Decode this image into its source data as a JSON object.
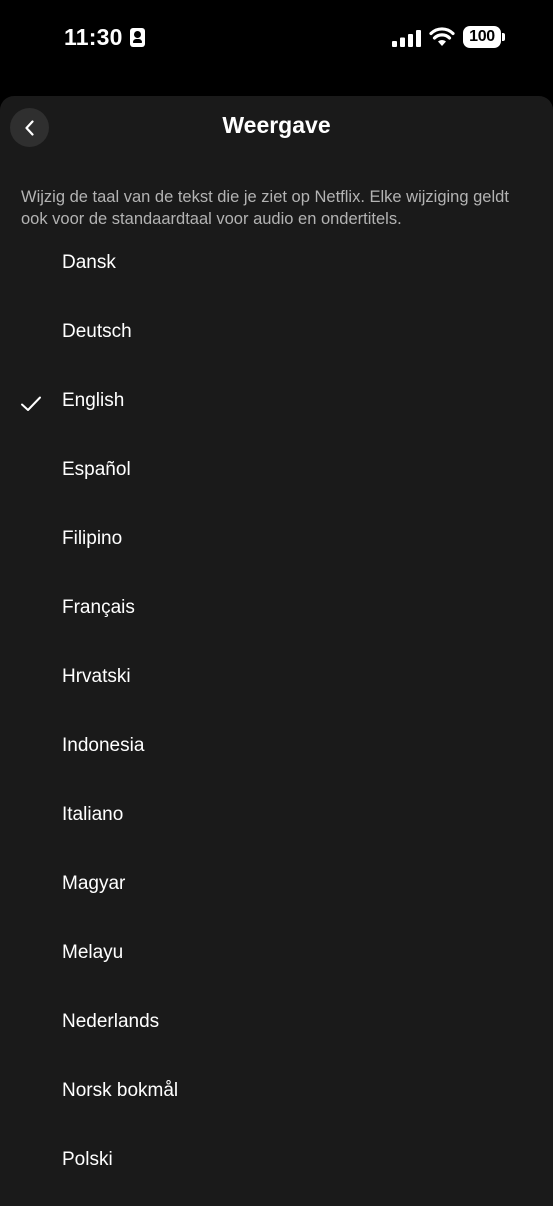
{
  "status_bar": {
    "time": "11:30",
    "battery": "100"
  },
  "header": {
    "title": "Weergave",
    "back_icon": "chevron-left-icon"
  },
  "description": "Wijzig de taal van de tekst die je ziet op Netflix. Elke wijziging geldt ook voor de standaardtaal voor audio en ondertitels.",
  "languages": [
    {
      "label": "Dansk",
      "selected": false
    },
    {
      "label": "Deutsch",
      "selected": false
    },
    {
      "label": "English",
      "selected": true
    },
    {
      "label": "Español",
      "selected": false
    },
    {
      "label": "Filipino",
      "selected": false
    },
    {
      "label": "Français",
      "selected": false
    },
    {
      "label": "Hrvatski",
      "selected": false
    },
    {
      "label": "Indonesia",
      "selected": false
    },
    {
      "label": "Italiano",
      "selected": false
    },
    {
      "label": "Magyar",
      "selected": false
    },
    {
      "label": "Melayu",
      "selected": false
    },
    {
      "label": "Nederlands",
      "selected": false
    },
    {
      "label": "Norsk bokmål",
      "selected": false
    },
    {
      "label": "Polski",
      "selected": false
    }
  ],
  "colors": {
    "background": "#000000",
    "sheet": "#1a1a1a",
    "text": "#ffffff",
    "secondary_text": "#b3b3b3"
  }
}
